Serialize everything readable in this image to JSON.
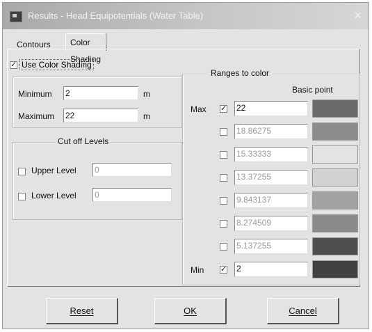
{
  "window": {
    "title": "Results - Head Equipotentials (Water Table)",
    "close_label": "×"
  },
  "tabs": [
    {
      "label": "Contours"
    },
    {
      "label": "Color Shading",
      "active": true
    }
  ],
  "use_color_shading": {
    "label": "Use Color Shading",
    "checked": true
  },
  "minmax": {
    "minimum": {
      "label": "Minimum",
      "value": "2",
      "unit": "m"
    },
    "maximum": {
      "label": "Maximum",
      "value": "22",
      "unit": "m"
    }
  },
  "cutoff": {
    "title": "Cut off Levels",
    "upper": {
      "label": "Upper Level",
      "value": "0",
      "checked": false
    },
    "lower": {
      "label": "Lower Level",
      "value": "0",
      "checked": false
    }
  },
  "ranges": {
    "title": "Ranges to color",
    "basic_point_label": "Basic point",
    "rows": [
      {
        "label": "Max",
        "checked": true,
        "value": "22",
        "color": "#6b6b6b"
      },
      {
        "label": "",
        "checked": false,
        "value": "18.86275",
        "color": "#8c8c8c"
      },
      {
        "label": "",
        "checked": false,
        "value": "15.33333",
        "color": "#e3e3e3"
      },
      {
        "label": "",
        "checked": false,
        "value": "13.37255",
        "color": "#d2d2d2"
      },
      {
        "label": "",
        "checked": false,
        "value": "9.843137",
        "color": "#a2a2a2"
      },
      {
        "label": "",
        "checked": false,
        "value": "8.274509",
        "color": "#8a8a8a"
      },
      {
        "label": "",
        "checked": false,
        "value": "5.137255",
        "color": "#4f4f4f"
      },
      {
        "label": "Min",
        "checked": true,
        "value": "2",
        "color": "#404040"
      }
    ]
  },
  "buttons": {
    "reset": "Reset",
    "ok": "OK",
    "cancel": "Cancel"
  }
}
